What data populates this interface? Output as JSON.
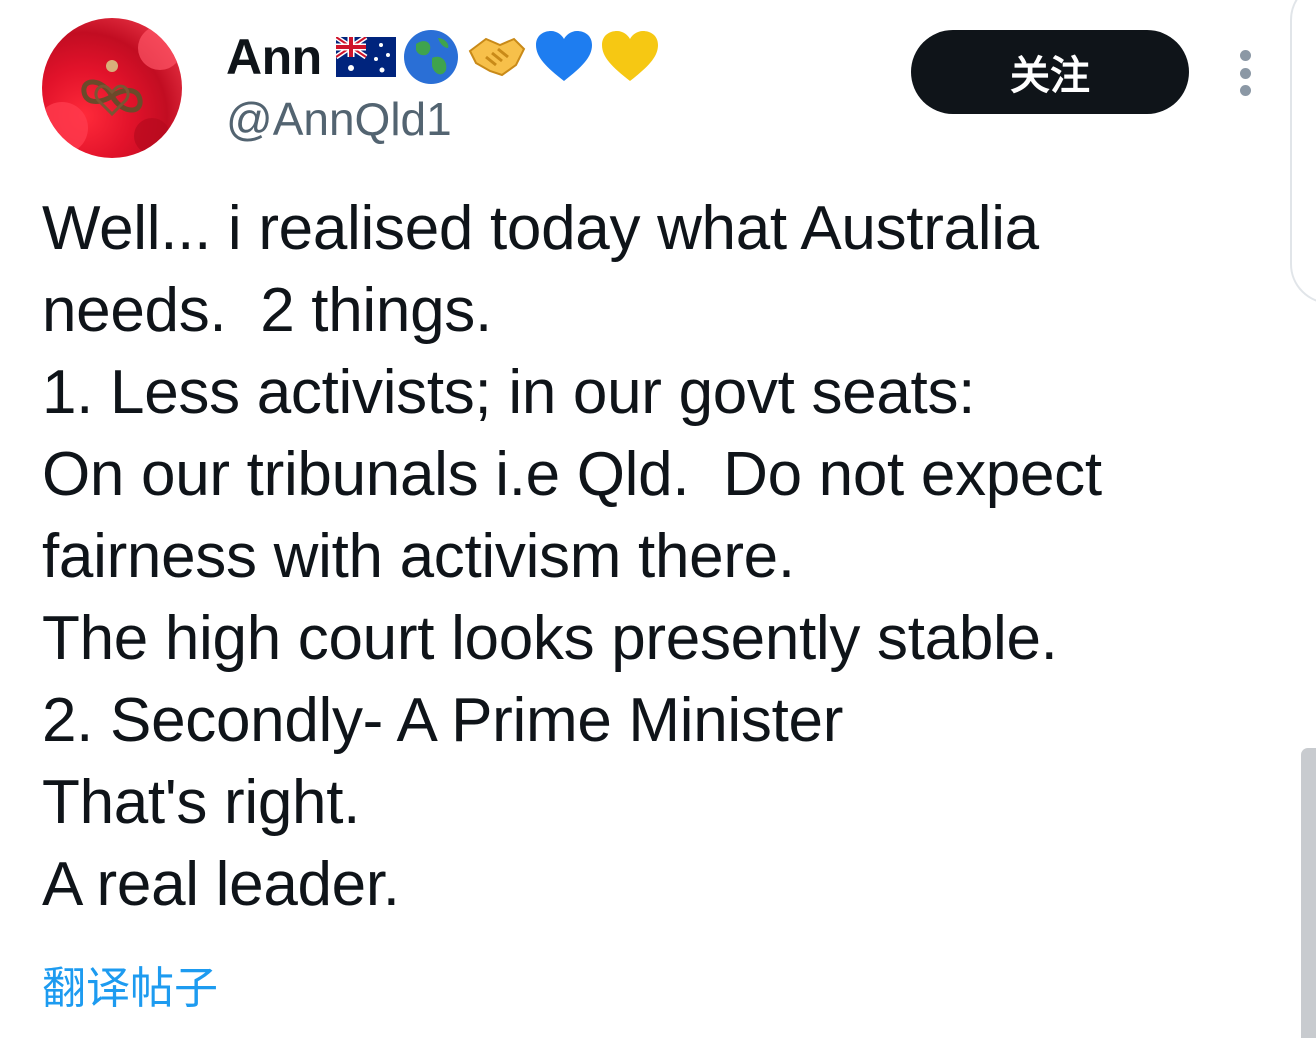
{
  "user": {
    "display_name": "Ann",
    "handle": "@AnnQld1",
    "avatar": "red-rose-infinity-avatar",
    "name_emojis": [
      "australian-flag-icon",
      "globe-icon",
      "handshake-icon",
      "blue-heart-icon",
      "yellow-heart-icon"
    ]
  },
  "actions": {
    "follow_label": "关注",
    "more_icon": "more-options-vertical-icon"
  },
  "tweet": {
    "lines": [
      "Well... i realised today what Australia",
      "needs.  2 things.",
      "1. Less activists; in our govt seats:",
      "On our tribunals i.e Qld.  Do not expect",
      "fairness with activism there.",
      "The high court looks presently stable.",
      "2. Secondly- A Prime Minister",
      "That's right.",
      "A real leader."
    ],
    "translate_label": "翻译帖子"
  },
  "colors": {
    "text": "#0f1419",
    "secondary_text": "#536471",
    "link": "#1d9bf0",
    "follow_bg": "#0f1419"
  }
}
